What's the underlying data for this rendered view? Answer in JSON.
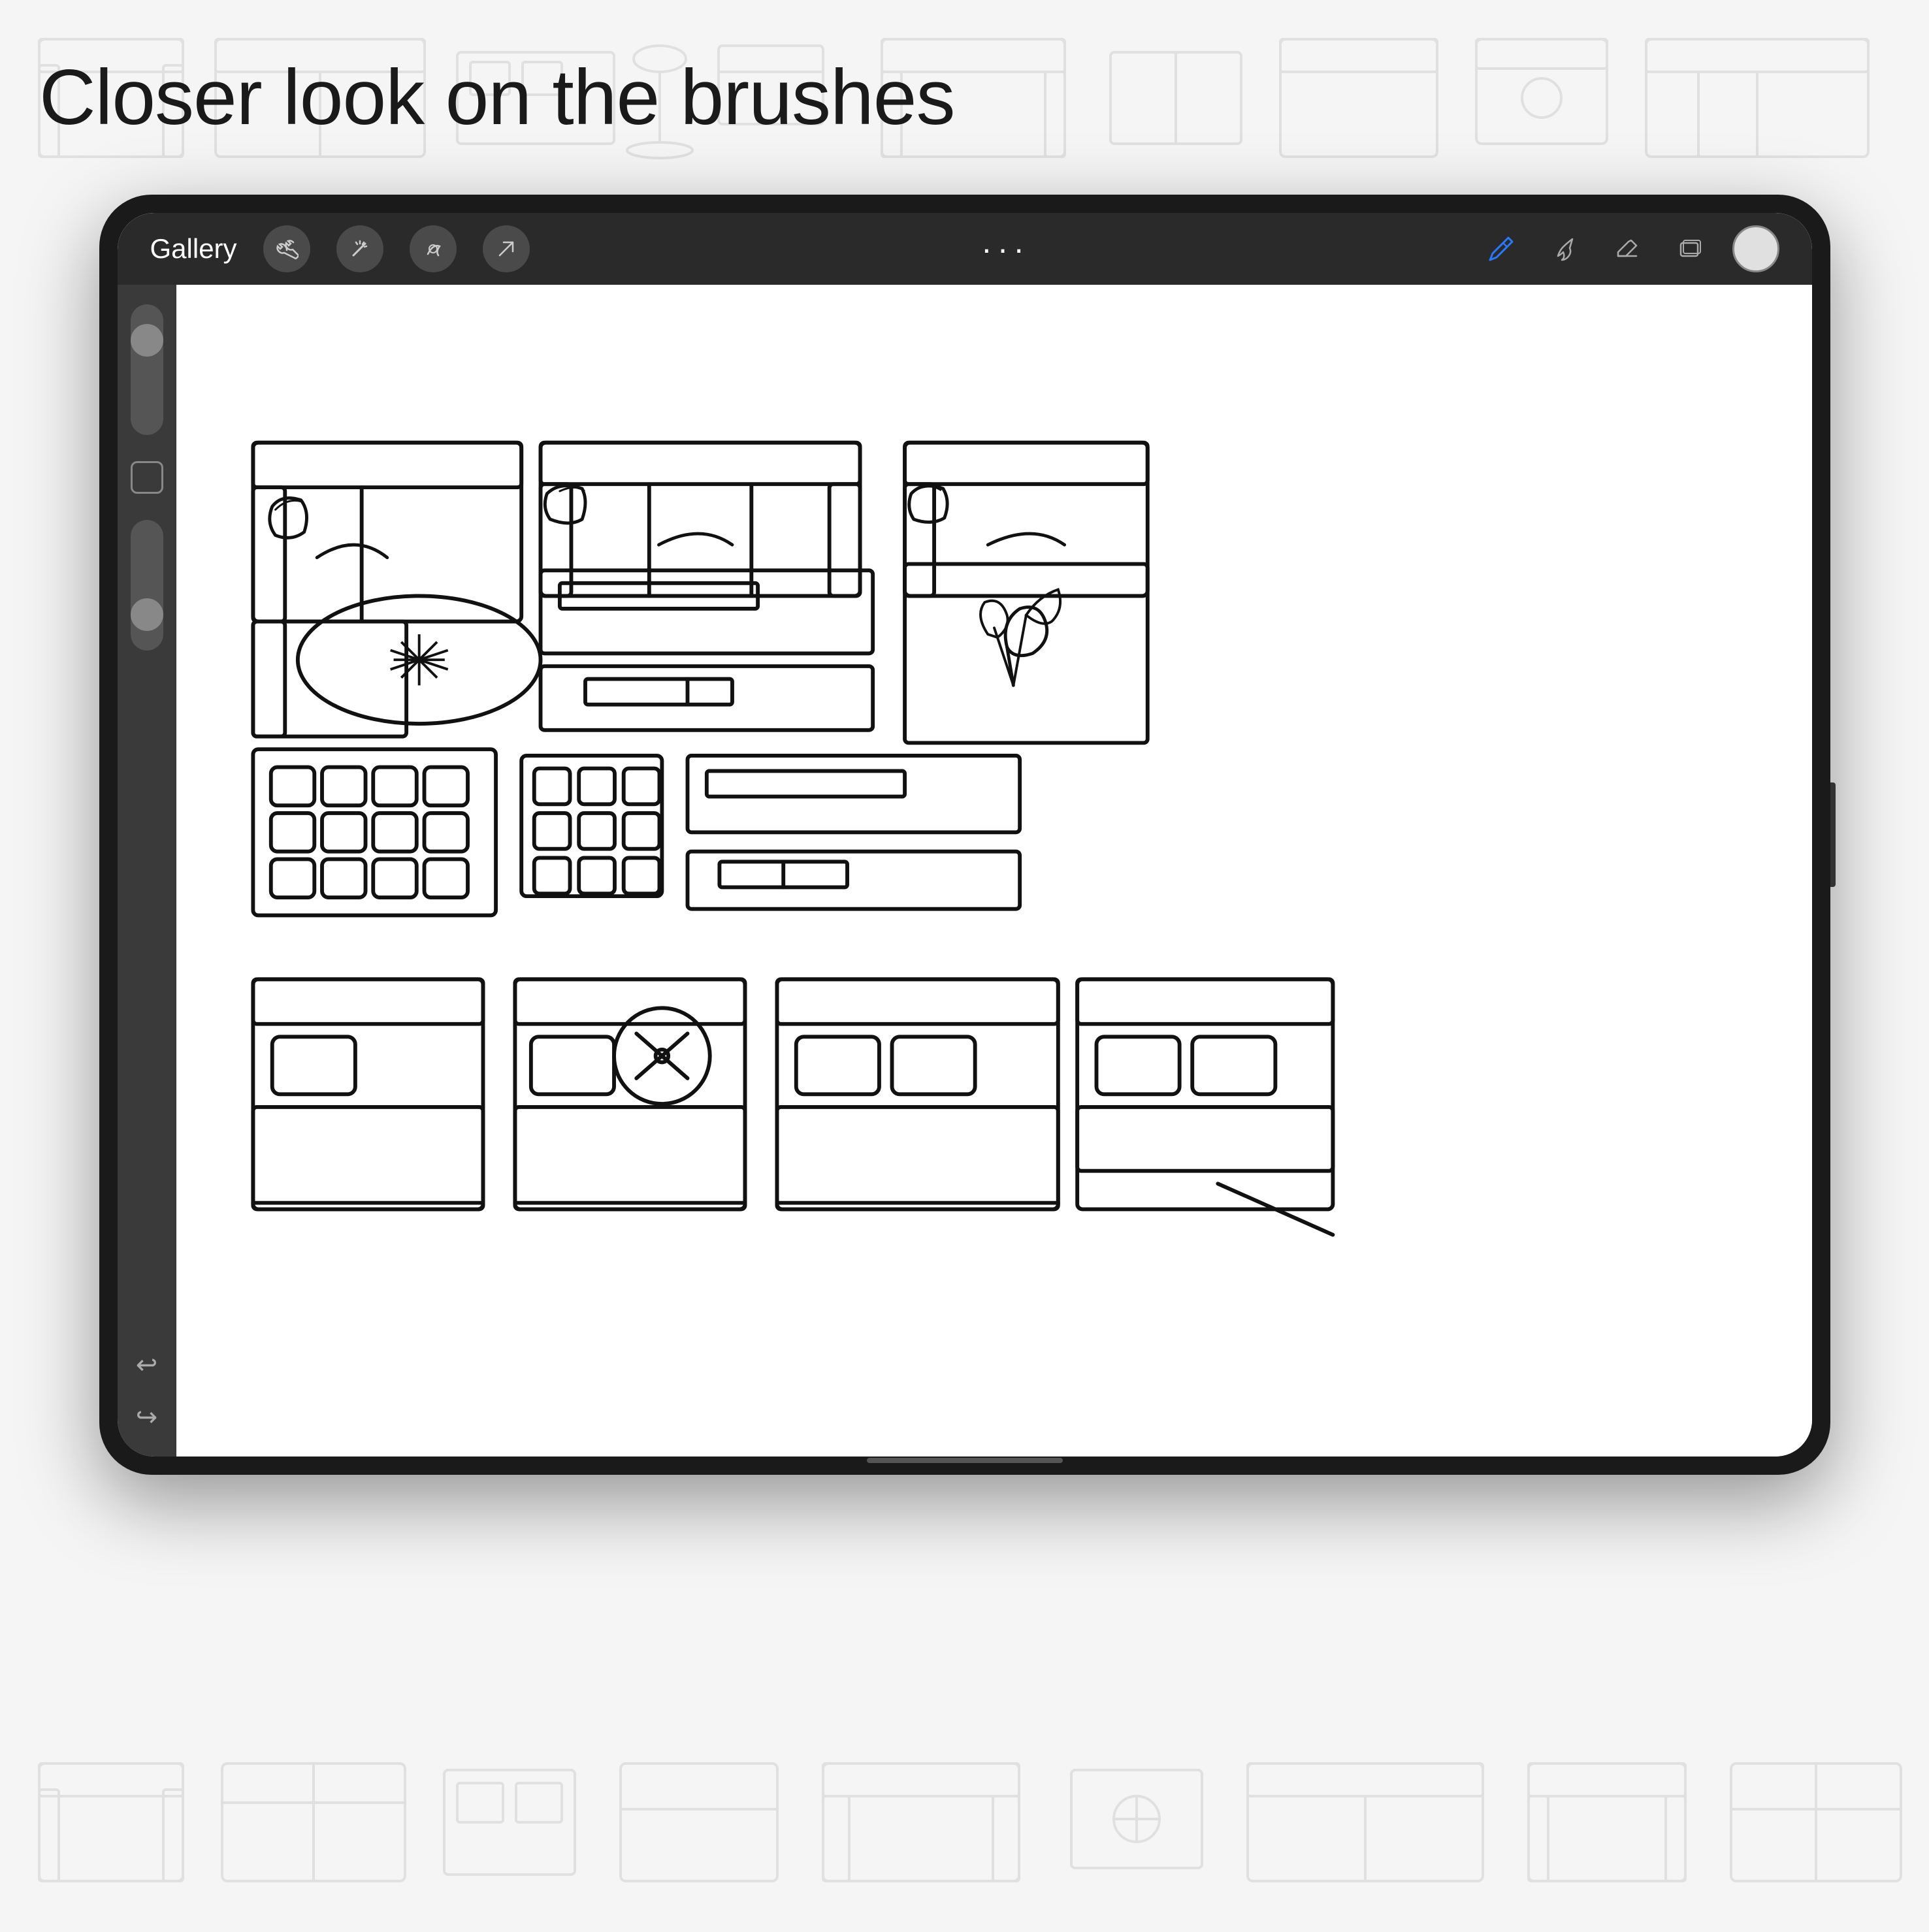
{
  "page": {
    "title": "Closer look on the brushes",
    "background_color": "#f5f5f5"
  },
  "toolbar": {
    "gallery_label": "Gallery",
    "dots_label": "···",
    "icons": [
      "wrench",
      "magic-wand",
      "s-tool",
      "arrow-tool"
    ]
  },
  "colors": {
    "ipad_frame": "#1a1a1a",
    "toolbar_bg": "#2d2d2d",
    "canvas_bg": "#ffffff",
    "side_panel_bg": "#3a3a3a",
    "accent_blue": "#2979ff"
  }
}
